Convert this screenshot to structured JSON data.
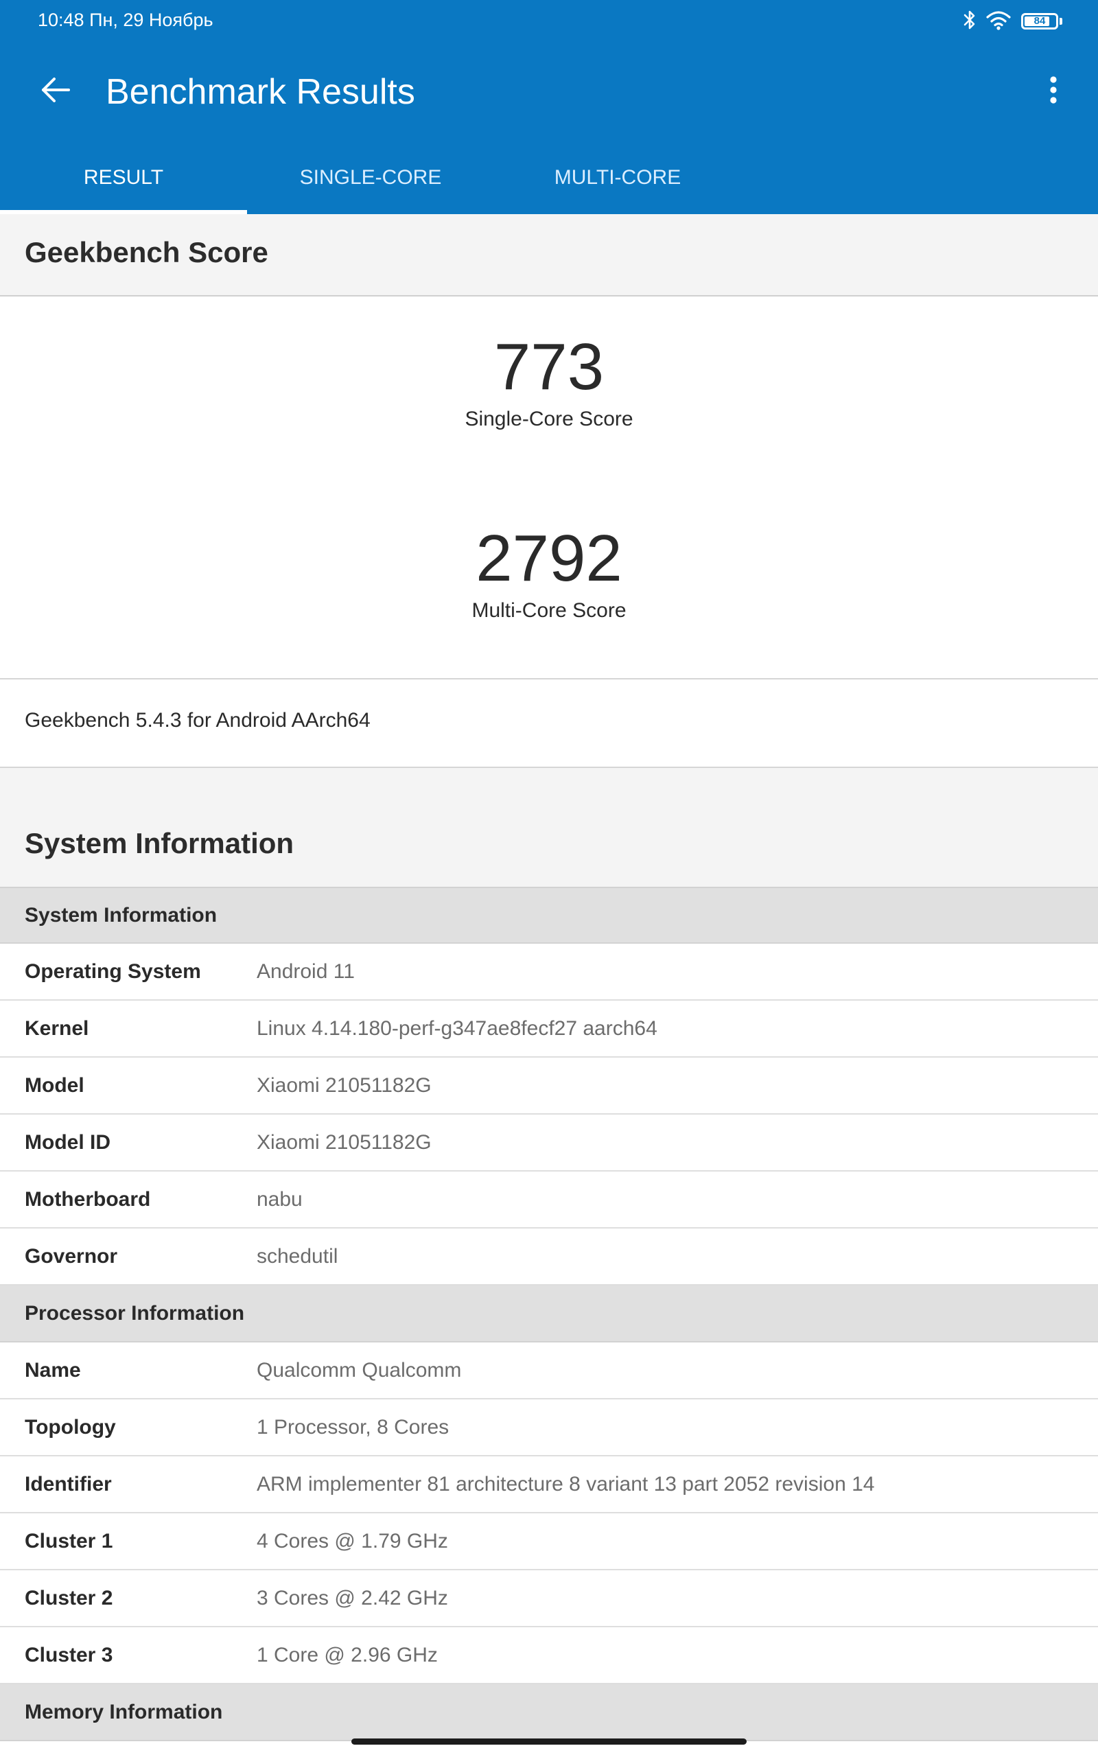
{
  "status_bar": {
    "time_date": "10:48  Пн, 29 Ноябрь",
    "battery": "84",
    "battery_level": 0.84
  },
  "toolbar": {
    "title": "Benchmark Results"
  },
  "tabs": [
    {
      "label": "RESULT",
      "active": true
    },
    {
      "label": "SINGLE-CORE",
      "active": false
    },
    {
      "label": "MULTI-CORE",
      "active": false
    }
  ],
  "score_section": {
    "title": "Geekbench Score",
    "single_core": {
      "value": "773",
      "label": "Single-Core Score"
    },
    "multi_core": {
      "value": "2792",
      "label": "Multi-Core Score"
    },
    "version": "Geekbench 5.4.3 for Android AArch64"
  },
  "system_section": {
    "title": "System Information",
    "groups": [
      {
        "title": "System Information",
        "rows": [
          {
            "key": "Operating System",
            "value": "Android 11"
          },
          {
            "key": "Kernel",
            "value": "Linux 4.14.180-perf-g347ae8fecf27 aarch64"
          },
          {
            "key": "Model",
            "value": "Xiaomi 21051182G"
          },
          {
            "key": "Model ID",
            "value": "Xiaomi 21051182G"
          },
          {
            "key": "Motherboard",
            "value": "nabu"
          },
          {
            "key": "Governor",
            "value": "schedutil"
          }
        ]
      },
      {
        "title": "Processor Information",
        "rows": [
          {
            "key": "Name",
            "value": "Qualcomm Qualcomm"
          },
          {
            "key": "Topology",
            "value": "1 Processor, 8 Cores"
          },
          {
            "key": "Identifier",
            "value": "ARM implementer 81 architecture 8 variant 13 part 2052 revision 14"
          },
          {
            "key": "Cluster 1",
            "value": "4 Cores @ 1.79 GHz"
          },
          {
            "key": "Cluster 2",
            "value": "3 Cores @ 2.42 GHz"
          },
          {
            "key": "Cluster 3",
            "value": "1 Core @ 2.96 GHz"
          }
        ]
      },
      {
        "title": "Memory Information",
        "rows": []
      }
    ]
  },
  "icons": {
    "back": "arrow-left-icon",
    "menu": "more-vertical-icon",
    "bluetooth": "bluetooth-icon",
    "wifi": "wifi-icon",
    "battery": "battery-icon"
  },
  "colors": {
    "app_bar": "#0a78c2",
    "section_background": "#f4f4f4",
    "group_header": "#e0e0e0"
  }
}
